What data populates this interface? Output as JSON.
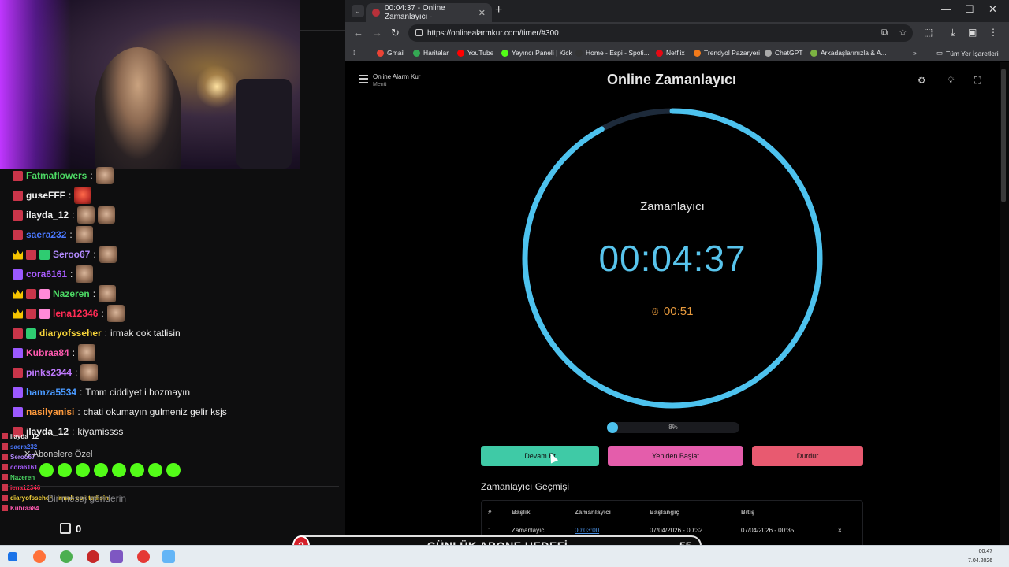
{
  "stream": {
    "chat": [
      {
        "user": "Fatmaflowers",
        "color": "#4cd964",
        "badges": [
          "mod"
        ],
        "message": "",
        "emotes": 1
      },
      {
        "user": "guseFFF",
        "color": "#f0f0f0",
        "badges": [
          "mod"
        ],
        "message": "",
        "emotes": 1,
        "emote_style": "red"
      },
      {
        "user": "ilayda_12",
        "color": "#f0f0f0",
        "badges": [
          "mod"
        ],
        "message": "",
        "emotes": 2
      },
      {
        "user": "saera232",
        "color": "#4a78ff",
        "badges": [
          "mod"
        ],
        "message": "",
        "emotes": 1
      },
      {
        "user": "Seroo67",
        "color": "#b38aff",
        "badges": [
          "crown",
          "mod",
          "gift"
        ],
        "message": "",
        "emotes": 1
      },
      {
        "user": "cora6161",
        "color": "#a85cff",
        "badges": [
          "sub"
        ],
        "message": "",
        "emotes": 1
      },
      {
        "user": "Nazeren",
        "color": "#4cd964",
        "badges": [
          "crown",
          "mod",
          "box"
        ],
        "message": "",
        "emotes": 1
      },
      {
        "user": "lena12346",
        "color": "#ff2b54",
        "badges": [
          "crown",
          "mod",
          "box"
        ],
        "message": "",
        "emotes": 1
      },
      {
        "user": "diaryofsseher",
        "color": "#f5d33a",
        "badges": [
          "mod",
          "gift"
        ],
        "message": "irmak cok tatlisin",
        "emotes": 0
      },
      {
        "user": "Kubraa84",
        "color": "#ff5ab0",
        "badges": [
          "sub"
        ],
        "message": "",
        "emotes": 1
      },
      {
        "user": "pinks2344",
        "color": "#c07aff",
        "badges": [
          "mod"
        ],
        "message": "",
        "emotes": 1
      },
      {
        "user": "hamza5534",
        "color": "#4a9aff",
        "badges": [
          "sub"
        ],
        "message": "Tmm ciddiyet i bozmayın",
        "emotes": 0
      },
      {
        "user": "nasilyanisi",
        "color": "#ff9a3c",
        "badges": [
          "sub"
        ],
        "message": "chati okumayın gulmeniz gelir ksjs",
        "emotes": 0
      },
      {
        "user": "ilayda_12",
        "color": "#f0f0f0",
        "badges": [
          "mod"
        ],
        "message": "kiyamissss",
        "emotes": 0
      }
    ],
    "overlay_lines": [
      {
        "user": "ilayda_12",
        "color": "#f0f0f0"
      },
      {
        "user": "saera232",
        "color": "#4a78ff"
      },
      {
        "user": "Seroo67",
        "color": "#b38aff"
      },
      {
        "user": "cora6161",
        "color": "#a85cff"
      },
      {
        "user": "Nazeren",
        "color": "#4cd964"
      },
      {
        "user": "lena12346",
        "color": "#ff2b54"
      },
      {
        "user": "diaryofsseher : irmak cok tatlisin",
        "color": "#f5d33a"
      },
      {
        "user": "Kubraa84",
        "color": "#ff5ab0"
      },
      {
        "user": "pinks2344",
        "color": "#c07aff"
      },
      {
        "user": "hamza5534 : Tmm ciddiyet i bozmayın",
        "color": "#4a9aff"
      }
    ],
    "sub_only_label": "Abonelere Özel",
    "chat_placeholder": "Bir mesaj gönderin",
    "gift_count": "0"
  },
  "browser": {
    "tab_title": "00:04:37 - Online Zamanlayıcı ·",
    "tab_close": "✕",
    "new_tab": "+",
    "url": "https://onlinealarmkur.com/timer/#300",
    "bookmarks": [
      {
        "label": "Gmail",
        "color": "#ea4335"
      },
      {
        "label": "Haritalar",
        "color": "#34a853"
      },
      {
        "label": "YouTube",
        "color": "#ff0000"
      },
      {
        "label": "Yayıncı Paneli | Kick",
        "color": "#53fc18"
      },
      {
        "label": "Home - Espi - Spoti...",
        "color": "#333333"
      },
      {
        "label": "Netflix",
        "color": "#e50914"
      },
      {
        "label": "Trendyol Pazaryeri",
        "color": "#f27a1a"
      },
      {
        "label": "ChatGPT",
        "color": "#aaaaaa"
      },
      {
        "label": "Arkadaşlarınızla & A...",
        "color": "#7cb342"
      }
    ],
    "bookmarks_more": "»",
    "all_bookmarks": "Tüm Yer İşaretleri"
  },
  "page": {
    "brand": "Online Alarm Kur",
    "brand_sub": "Menü",
    "title": "Online Zamanlayıcı",
    "timer_label": "Zamanlayıcı",
    "time": "00:04:37",
    "alarm_time": "00:51",
    "progress_fraction": 0.08,
    "progress_text": "8%",
    "buttons": {
      "resume": "Devam Et",
      "restart": "Yeniden Başlat",
      "stop": "Durdur"
    },
    "history_title": "Zamanlayıcı Geçmişi",
    "history_headers": [
      "#",
      "Başlık",
      "Zamanlayıcı",
      "Başlangıç",
      "Bitiş"
    ],
    "history_rows": [
      {
        "num": "1",
        "title": "Zamanlayıcı",
        "timer": "00:03:00",
        "start": "07/04/2026 - 00:32",
        "end": "07/04/2026 - 00:35",
        "delete": "×"
      }
    ],
    "ring_color": "#4dc2ee",
    "ring_track_color": "#1d2a3a"
  },
  "goal": {
    "current": "2",
    "title": "GÜNLÜK ABONE HEDEFİ",
    "target": "55"
  },
  "taskbar": {
    "time": "00:47",
    "date": "7.04.2026"
  }
}
